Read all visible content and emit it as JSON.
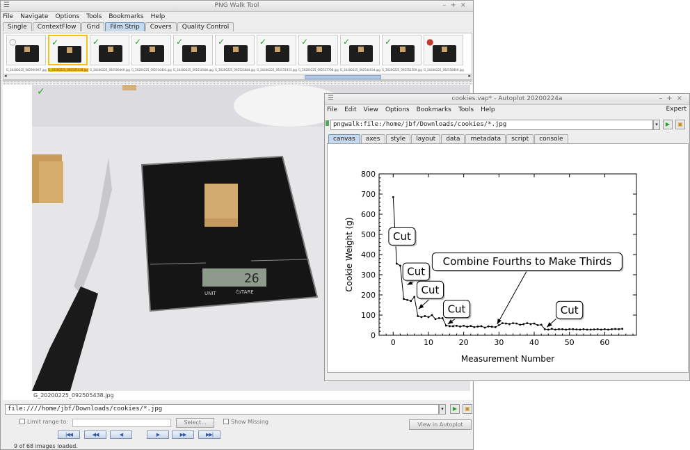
{
  "pngwalk": {
    "title": "PNG Walk Tool",
    "menu": [
      "File",
      "Navigate",
      "Options",
      "Tools",
      "Bookmarks",
      "Help"
    ],
    "tabs": [
      "Single",
      "ContextFlow",
      "Grid",
      "Film Strip",
      "Covers",
      "Quality Control"
    ],
    "active_tab": "Film Strip",
    "thumbnails": [
      {
        "label": "G_20200225_082900947.jpg",
        "selected": false,
        "check": "none"
      },
      {
        "label": "G_20200225_092505438.jpg",
        "selected": true,
        "check": "ok"
      },
      {
        "label": "G_20200225_092509469.jpg",
        "selected": false,
        "check": "ok"
      },
      {
        "label": "G_20200225_092516403.jpg",
        "selected": false,
        "check": "ok"
      },
      {
        "label": "G_20200225_092518580.jpg",
        "selected": false,
        "check": "ok"
      },
      {
        "label": "G_20200225_092523684.jpg",
        "selected": false,
        "check": "ok"
      },
      {
        "label": "G_20200225_092531933.jpg",
        "selected": false,
        "check": "ok"
      },
      {
        "label": "G_20200225_092537798.jpg",
        "selected": false,
        "check": "ok"
      },
      {
        "label": "G_20200225_092544034.jpg",
        "selected": false,
        "check": "ok"
      },
      {
        "label": "G_20200225_092551569.jpg",
        "selected": false,
        "check": "ok"
      },
      {
        "label": "G_20200225_092558869.jpg",
        "selected": false,
        "check": "bad"
      }
    ],
    "image_caption": "G_20200225_092505438.jpg",
    "scale_display": "26",
    "scale_unit_label": "UNIT",
    "scale_tare_label": "⏻/TARE",
    "path": "file:////home/jbf/Downloads/cookies/*.jpg",
    "limit_range_label": "Limit range to:",
    "select_button": "Select...",
    "show_missing_label": "Show Missing",
    "view_in_autoplot": "View in Autoplot",
    "nav_buttons": [
      "|◀◀",
      "◀◀",
      "◀",
      "▶",
      "▶▶",
      "▶▶|"
    ],
    "status": "9 of 68 images loaded."
  },
  "autoplot": {
    "title": "cookies.vap* - Autoplot 20200224a",
    "menu": [
      "File",
      "Edit",
      "View",
      "Options",
      "Bookmarks",
      "Tools",
      "Help"
    ],
    "expert_label": "Expert",
    "uri": "pngwalk:file:/home/jbf/Downloads/cookies/*.jpg",
    "tabs": [
      "canvas",
      "axes",
      "style",
      "layout",
      "data",
      "metadata",
      "script",
      "console"
    ],
    "active_tab": "canvas"
  },
  "chart_data": {
    "type": "line",
    "xlabel": "Measurement Number",
    "ylabel": "Cookie Weight (g)",
    "xlim": [
      -4,
      69
    ],
    "ylim": [
      0,
      800
    ],
    "xticks": [
      0,
      10,
      20,
      30,
      40,
      50,
      60
    ],
    "yticks": [
      0,
      100,
      200,
      300,
      400,
      500,
      600,
      700,
      800
    ],
    "series": [
      {
        "x": [
          0,
          1,
          2,
          3,
          4,
          5,
          6,
          7,
          8,
          9,
          10,
          11,
          12,
          13,
          14,
          15,
          16,
          17,
          18,
          19,
          20,
          21,
          22,
          23,
          24,
          25,
          26,
          27,
          28,
          29,
          30,
          31,
          32,
          33,
          34,
          35,
          36,
          37,
          38,
          39,
          40,
          41,
          42,
          43,
          44,
          45,
          46,
          47,
          48,
          49,
          50,
          51,
          52,
          53,
          54,
          55,
          56,
          57,
          58,
          59,
          60,
          61,
          62,
          63,
          64,
          65
        ],
        "y": [
          685,
          355,
          345,
          180,
          175,
          170,
          190,
          95,
          90,
          95,
          90,
          100,
          80,
          85,
          85,
          48,
          45,
          45,
          47,
          43,
          47,
          42,
          46,
          40,
          43,
          45,
          38,
          44,
          42,
          40,
          50,
          60,
          58,
          55,
          60,
          58,
          52,
          55,
          60,
          55,
          58,
          50,
          52,
          30,
          28,
          32,
          28,
          30,
          30,
          28,
          30,
          30,
          29,
          28,
          30,
          28,
          28,
          29,
          30,
          28,
          30,
          28,
          30,
          31,
          30,
          32
        ]
      }
    ],
    "annotations": [
      {
        "text": "Cut",
        "x": 2.5,
        "y": 490,
        "ax": 2.6,
        "ay": 490
      },
      {
        "text": "Cut",
        "x": 6.5,
        "y": 315,
        "ax": 4.0,
        "ay": 250
      },
      {
        "text": "Cut",
        "x": 10.5,
        "y": 225,
        "ax": 7.2,
        "ay": 130
      },
      {
        "text": "Cut",
        "x": 18,
        "y": 130,
        "ax": 15.5,
        "ay": 55
      },
      {
        "text": "Combine Fourths to Make Thirds",
        "x": 38,
        "y": 365,
        "ax": 29.5,
        "ay": 55
      },
      {
        "text": "Cut",
        "x": 50,
        "y": 125,
        "ax": 43.6,
        "ay": 40
      }
    ]
  }
}
